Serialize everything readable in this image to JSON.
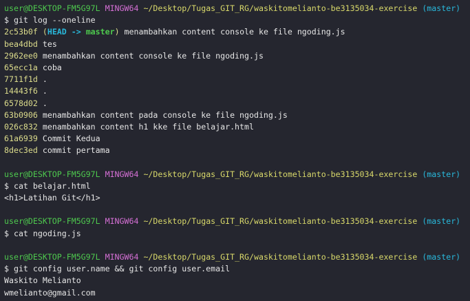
{
  "prompt": {
    "user": "user@DESKTOP-FM5G97L",
    "system": "MINGW64",
    "path": "~/Desktop/Tugas_GIT_RG/waskitomelianto-be3135034-exercise",
    "branch": "(master)"
  },
  "colors": {
    "user": "#4ec94e",
    "system": "#d670d6",
    "path": "#d8d86a",
    "branch": "#29b8db",
    "hash": "#dcdc8c",
    "background": "#25262f"
  },
  "blocks": [
    {
      "command": "$ git log --oneline",
      "log": [
        {
          "hash": "2c53b0f",
          "ref_open": " (",
          "head": "HEAD",
          "arrow": " -> ",
          "ref_branch": "master",
          "ref_close": ")",
          "message": " menambahkan content console ke file ngoding.js"
        },
        {
          "hash": "bea4dbd",
          "message": " tes"
        },
        {
          "hash": "2962ee0",
          "message": " menambahkan content console ke file ngoding.js"
        },
        {
          "hash": "65ecc1a",
          "message": " coba"
        },
        {
          "hash": "7711f1d",
          "message": " ."
        },
        {
          "hash": "14443f6",
          "message": " ."
        },
        {
          "hash": "6578d02",
          "message": " ."
        },
        {
          "hash": "63b0906",
          "message": " menambahkan content pada console ke file ngoding.js"
        },
        {
          "hash": "026c832",
          "message": " menambahkan content h1 kke file belajar.html"
        },
        {
          "hash": "61a6939",
          "message": " Commit Kedua"
        },
        {
          "hash": "8dec3ed",
          "message": " commit pertama"
        }
      ]
    },
    {
      "command": "$ cat belajar.html",
      "output": [
        "<h1>Latihan Git</h1>"
      ]
    },
    {
      "command": "$ cat ngoding.js",
      "output": []
    },
    {
      "command": "$ git config user.name && git config user.email",
      "output": [
        "Waskito Melianto",
        "wmelianto@gmail.com"
      ]
    }
  ]
}
